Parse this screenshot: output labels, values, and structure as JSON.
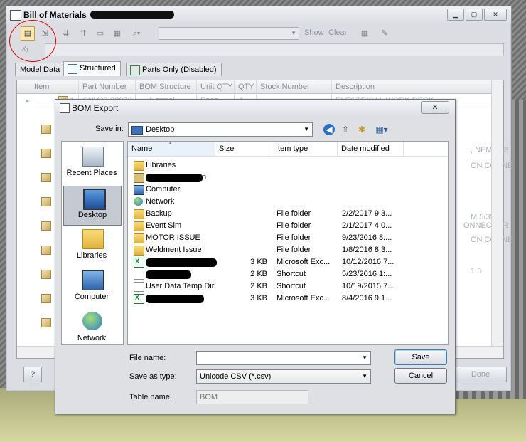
{
  "bom_window": {
    "title": "Bill of Materials",
    "toolbar": {
      "show_label": "Show",
      "clear_label": "Clear"
    },
    "formula_icon": "x-subscript-icon",
    "tabs": [
      {
        "label": "Model Data"
      },
      {
        "label": "Structured"
      },
      {
        "label": "Parts Only (Disabled)"
      }
    ],
    "columns": [
      "Item",
      "Part Number",
      "BOM Structure",
      "Unit QTY",
      "QTY",
      "Stock Number",
      "Description"
    ],
    "first_row": {
      "item": "1",
      "part_number": "CNV02-20070",
      "bom_structure": "Normal",
      "unit_qty": "Each",
      "qty": "1",
      "description": "ELECTRICAL WORK DECK"
    },
    "partial_descriptions": [
      ", NEMA 12",
      "ON CONNE",
      "M 5/35",
      "ONNECTOR",
      "ON CONNE",
      "1 5"
    ],
    "done_label": "Done",
    "help_label": "?"
  },
  "dialog": {
    "title": "BOM Export",
    "close_label": "✕",
    "save_in_label": "Save in:",
    "save_in_value": "Desktop",
    "places": [
      {
        "label": "Recent Places",
        "icon": "recent-places-icon"
      },
      {
        "label": "Desktop",
        "icon": "desktop-icon"
      },
      {
        "label": "Libraries",
        "icon": "libraries-icon"
      },
      {
        "label": "Computer",
        "icon": "computer-icon"
      },
      {
        "label": "Network",
        "icon": "network-icon"
      }
    ],
    "columns": {
      "name": "Name",
      "size": "Size",
      "type": "Item type",
      "date": "Date modified"
    },
    "files": [
      {
        "name": "Libraries",
        "size": "",
        "type": "",
        "date": "",
        "icon": "libraries-icon"
      },
      {
        "name": "",
        "size": "",
        "type": "",
        "date": "",
        "icon": "user-icon",
        "redacted": true,
        "visible_suffix": "n"
      },
      {
        "name": "Computer",
        "size": "",
        "type": "",
        "date": "",
        "icon": "computer-icon"
      },
      {
        "name": "Network",
        "size": "",
        "type": "",
        "date": "",
        "icon": "network-icon"
      },
      {
        "name": "Backup",
        "size": "",
        "type": "File folder",
        "date": "2/2/2017 9:3...",
        "icon": "folder-icon"
      },
      {
        "name": "Event Sim",
        "size": "",
        "type": "File folder",
        "date": "2/1/2017 4:0...",
        "icon": "folder-icon"
      },
      {
        "name": "MOTOR ISSUE",
        "size": "",
        "type": "File folder",
        "date": "9/23/2016 8:...",
        "icon": "folder-icon"
      },
      {
        "name": "Weldment Issue",
        "size": "",
        "type": "File folder",
        "date": "1/8/2016 8:3...",
        "icon": "folder-icon"
      },
      {
        "name": "",
        "size": "3 KB",
        "type": "Microsoft Exc...",
        "date": "10/12/2016 7...",
        "icon": "excel-icon",
        "redacted": true
      },
      {
        "name": "",
        "size": "2 KB",
        "type": "Shortcut",
        "date": "5/23/2016 1:...",
        "icon": "shortcut-icon",
        "redacted": true
      },
      {
        "name": "User Data Temp Dir",
        "size": "2 KB",
        "type": "Shortcut",
        "date": "10/19/2015 7...",
        "icon": "shortcut-icon"
      },
      {
        "name": "",
        "size": "3 KB",
        "type": "Microsoft Exc...",
        "date": "8/4/2016 9:1...",
        "icon": "excel-icon",
        "redacted": true
      }
    ],
    "file_name_label": "File name:",
    "file_name_value": "",
    "save_as_type_label": "Save as type:",
    "save_as_type_value": "Unicode CSV (*.csv)",
    "table_name_label": "Table name:",
    "table_name_value": "BOM",
    "save_label": "Save",
    "cancel_label": "Cancel"
  }
}
